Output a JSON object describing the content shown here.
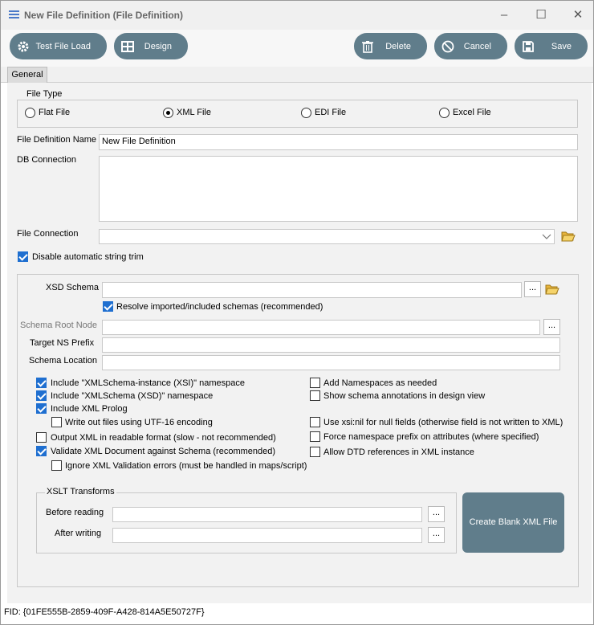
{
  "window": {
    "title": "New File Definition (File Definition)"
  },
  "toolbar": {
    "test_file_load": "Test File Load",
    "design": "Design",
    "delete": "Delete",
    "cancel": "Cancel",
    "save": "Save"
  },
  "tabs": {
    "general": "General"
  },
  "file_type": {
    "legend": "File Type",
    "options": [
      "Flat File",
      "XML File",
      "EDI File",
      "Excel File"
    ],
    "selected": "XML File"
  },
  "file_definition_name": {
    "label": "File Definition Name",
    "value": "New File Definition"
  },
  "db_connection": {
    "label": "DB Connection",
    "value": ""
  },
  "file_connection": {
    "label": "File Connection",
    "value": ""
  },
  "disable_trim": {
    "label": "Disable automatic string trim",
    "checked": true
  },
  "xsd_schema": {
    "label": "XSD Schema",
    "value": ""
  },
  "resolve_imported": {
    "label": "Resolve imported/included schemas (recommended)",
    "checked": true
  },
  "schema_root_node": {
    "label": "Schema Root Node",
    "value": ""
  },
  "target_ns_prefix": {
    "label": "Target NS Prefix",
    "value": ""
  },
  "schema_location": {
    "label": "Schema Location",
    "value": ""
  },
  "options": {
    "include_xsi": {
      "label": "Include \"XMLSchema-instance (XSI)\" namespace",
      "checked": true
    },
    "include_xsd": {
      "label": "Include \"XMLSchema (XSD)\" namespace",
      "checked": true
    },
    "include_prolog": {
      "label": "Include XML Prolog",
      "checked": true
    },
    "utf16": {
      "label": "Write out files using UTF-16 encoding",
      "checked": false
    },
    "readable": {
      "label": "Output XML in readable format (slow - not recommended)",
      "checked": false
    },
    "validate": {
      "label": "Validate XML Document against Schema (recommended)",
      "checked": true
    },
    "ignore_validation": {
      "label": "Ignore XML Validation errors (must be handled in maps/script)",
      "checked": false
    },
    "add_namespaces": {
      "label": "Add Namespaces as needed",
      "checked": false
    },
    "show_annotations": {
      "label": "Show schema annotations in design view",
      "checked": false
    },
    "use_xsi_nil": {
      "label": "Use xsi:nil for null fields (otherwise field is not written to XML)",
      "checked": false
    },
    "force_ns_prefix": {
      "label": "Force namespace prefix on attributes (where specified)",
      "checked": false
    },
    "allow_dtd": {
      "label": "Allow DTD references in XML instance",
      "checked": false
    }
  },
  "xslt": {
    "legend": "XSLT Transforms",
    "before_label": "Before reading",
    "after_label": "After writing",
    "before_value": "",
    "after_value": ""
  },
  "create_blank_xml": "Create Blank XML File",
  "ellipsis": "...",
  "status": {
    "fid": "FID: {01FE555B-2859-409F-A428-814A5E50727F}"
  },
  "colors": {
    "button": "#607d8b",
    "checkbox": "#1f6fd0",
    "panel": "#f2f2f2"
  }
}
